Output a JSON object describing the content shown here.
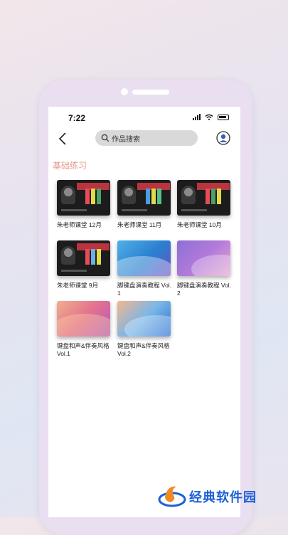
{
  "status_bar": {
    "time": "7:22"
  },
  "nav": {
    "search_placeholder": "作品搜索"
  },
  "section": {
    "title": "基础练习"
  },
  "works": [
    {
      "title": "朱老师课堂 12月",
      "style": "dark",
      "bars": [
        "#e94b5a",
        "#e0d94a",
        "#4ca06a"
      ]
    },
    {
      "title": "朱老师课堂 11月",
      "style": "dark",
      "bars": [
        "#4a9be0",
        "#e0d94a",
        "#5ac08a"
      ]
    },
    {
      "title": "朱老师课堂 10月",
      "style": "dark",
      "bars": [
        "#e94b5a",
        "#4ca06a",
        "#e0d94a"
      ]
    },
    {
      "title": "朱老师课堂 9月",
      "style": "dark",
      "bars": [
        "#e94b5a",
        "#6bb0e0",
        "#e0d94a"
      ]
    },
    {
      "title": "脚键盘演奏教程 Vol.1",
      "style": "blue"
    },
    {
      "title": "脚键盘演奏教程 Vol.2",
      "style": "purple"
    },
    {
      "title": "键盘和声&伴奏风格 Vol.1",
      "style": "orange"
    },
    {
      "title": "键盘和声&伴奏风格 Vol.2",
      "style": "blue2"
    }
  ],
  "watermark": {
    "text": "经典软件园"
  },
  "colors": {
    "accent_section_title": "#e39b91",
    "search_bg": "#d9d9d9",
    "watermark_blue": "#1d5fd6"
  },
  "icons": [
    "back-icon",
    "search-icon",
    "avatar-icon",
    "signal-icon",
    "wifi-icon",
    "battery-icon"
  ]
}
